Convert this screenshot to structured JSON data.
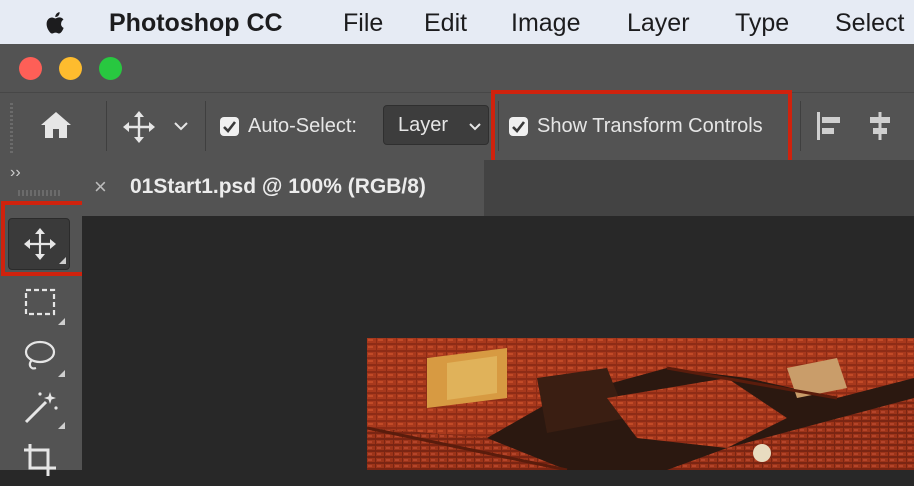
{
  "menubar": {
    "app_name": "Photoshop CC",
    "items": [
      "File",
      "Edit",
      "Image",
      "Layer",
      "Type",
      "Select"
    ]
  },
  "options_bar": {
    "auto_select_label": "Auto-Select:",
    "auto_select_checked": true,
    "auto_select_target": "Layer",
    "show_transform_label": "Show Transform Controls",
    "show_transform_checked": true
  },
  "tools_panel": {
    "collapse_glyph": "››",
    "tools": [
      {
        "name": "move-tool",
        "icon": "move-icon",
        "active": true
      },
      {
        "name": "rectangular-marquee-tool",
        "icon": "marquee-icon",
        "active": false
      },
      {
        "name": "lasso-tool",
        "icon": "lasso-icon",
        "active": false
      },
      {
        "name": "magic-wand-tool",
        "icon": "magic-wand-icon",
        "active": false
      },
      {
        "name": "crop-tool",
        "icon": "crop-icon",
        "active": false
      }
    ]
  },
  "document": {
    "tab_title": "01Start1.psd @ 100% (RGB/8)",
    "close_glyph": "×"
  },
  "colors": {
    "highlight": "#d0220d",
    "panel": "#535353",
    "canvas": "#282828",
    "menubar": "#e6ebf4"
  }
}
